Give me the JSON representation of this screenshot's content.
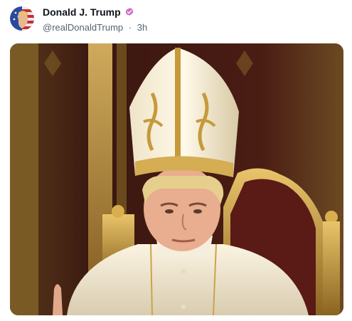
{
  "post": {
    "author": {
      "display_name": "Donald J. Trump",
      "handle": "@realDonaldTrump",
      "separator": "·",
      "time": "3h",
      "verified_icon": "verified-badge-icon",
      "badge_color": "#d16bc4"
    },
    "media": {
      "type": "image",
      "subject": "man-in-papal-vestments-and-mitre-seated-on-gilded-throne"
    }
  }
}
